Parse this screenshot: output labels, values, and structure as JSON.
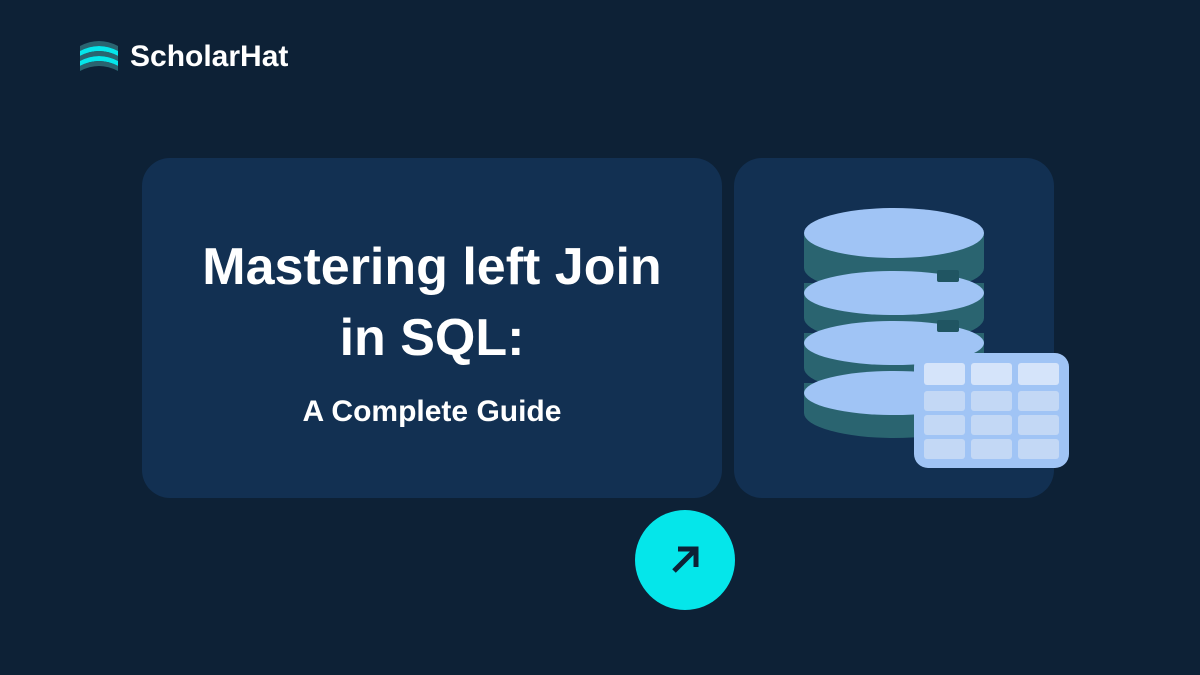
{
  "brand": {
    "name": "ScholarHat"
  },
  "content": {
    "title": "Mastering left Join in SQL:",
    "subtitle": "A Complete Guide"
  },
  "colors": {
    "background": "#0d2136",
    "card": "#123052",
    "accent": "#05e6ea",
    "dbLight": "#a0c4f5",
    "dbDark": "#2a6470"
  }
}
